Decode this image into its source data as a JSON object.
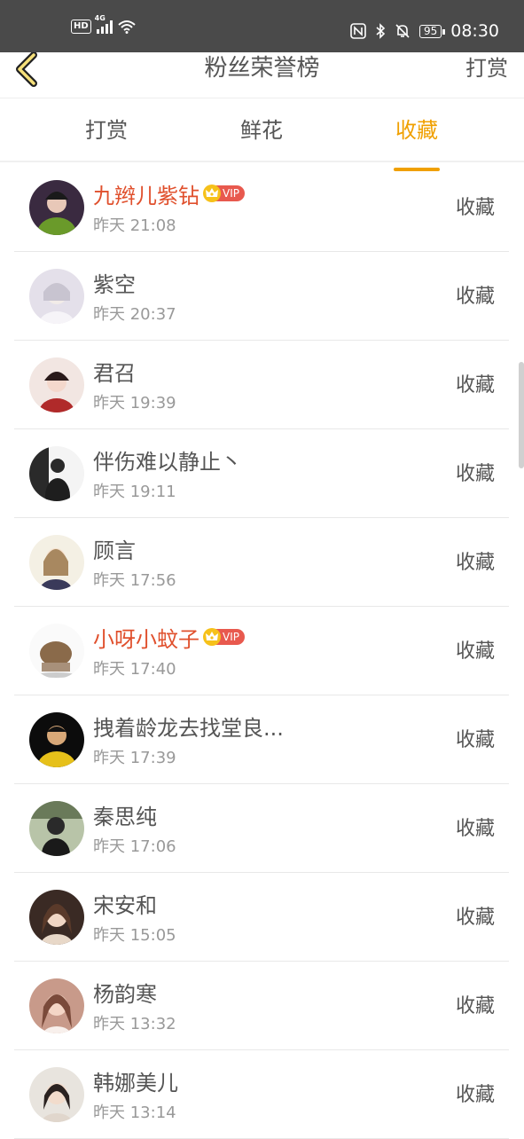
{
  "status_bar": {
    "hd_label": "HD",
    "network_label": "4G",
    "battery_level": "95",
    "time": "08:30",
    "icons": [
      "wifi-icon",
      "nfc-icon",
      "bluetooth-icon",
      "bell-off-icon"
    ]
  },
  "nav": {
    "back_icon": "chevron-left-icon",
    "title": "粉丝荣誉榜",
    "right_label": "打赏"
  },
  "tabs": [
    {
      "label": "打赏",
      "active": false
    },
    {
      "label": "鲜花",
      "active": false
    },
    {
      "label": "收藏",
      "active": true
    }
  ],
  "colors": {
    "accent": "#f0a000",
    "vip_name": "#e0502d",
    "vip_badge": "#e8594e",
    "crown": "#f6c11a",
    "status_bar": "#4a4a4a"
  },
  "fans": [
    {
      "name": "九辫儿紫钻",
      "vip": true,
      "vip_label": "VIP",
      "time": "昨天 21:08",
      "action": "收藏"
    },
    {
      "name": "紫空",
      "vip": false,
      "time": "昨天 20:37",
      "action": "收藏"
    },
    {
      "name": "君召",
      "vip": false,
      "time": "昨天 19:39",
      "action": "收藏"
    },
    {
      "name": "伴伤难以静止丶",
      "vip": false,
      "time": "昨天 19:11",
      "action": "收藏"
    },
    {
      "name": "顾言",
      "vip": false,
      "time": "昨天 17:56",
      "action": "收藏"
    },
    {
      "name": "小呀小蚊子",
      "vip": true,
      "vip_label": "VIP",
      "time": "昨天 17:40",
      "action": "收藏"
    },
    {
      "name": "拽着龄龙去找堂良...",
      "vip": false,
      "time": "昨天 17:39",
      "action": "收藏"
    },
    {
      "name": "秦思纯",
      "vip": false,
      "time": "昨天 17:06",
      "action": "收藏"
    },
    {
      "name": "宋安和",
      "vip": false,
      "time": "昨天 15:05",
      "action": "收藏"
    },
    {
      "name": "杨韵寒",
      "vip": false,
      "time": "昨天 13:32",
      "action": "收藏"
    },
    {
      "name": "韩娜美儿",
      "vip": false,
      "time": "昨天 13:14",
      "action": "收藏"
    }
  ]
}
